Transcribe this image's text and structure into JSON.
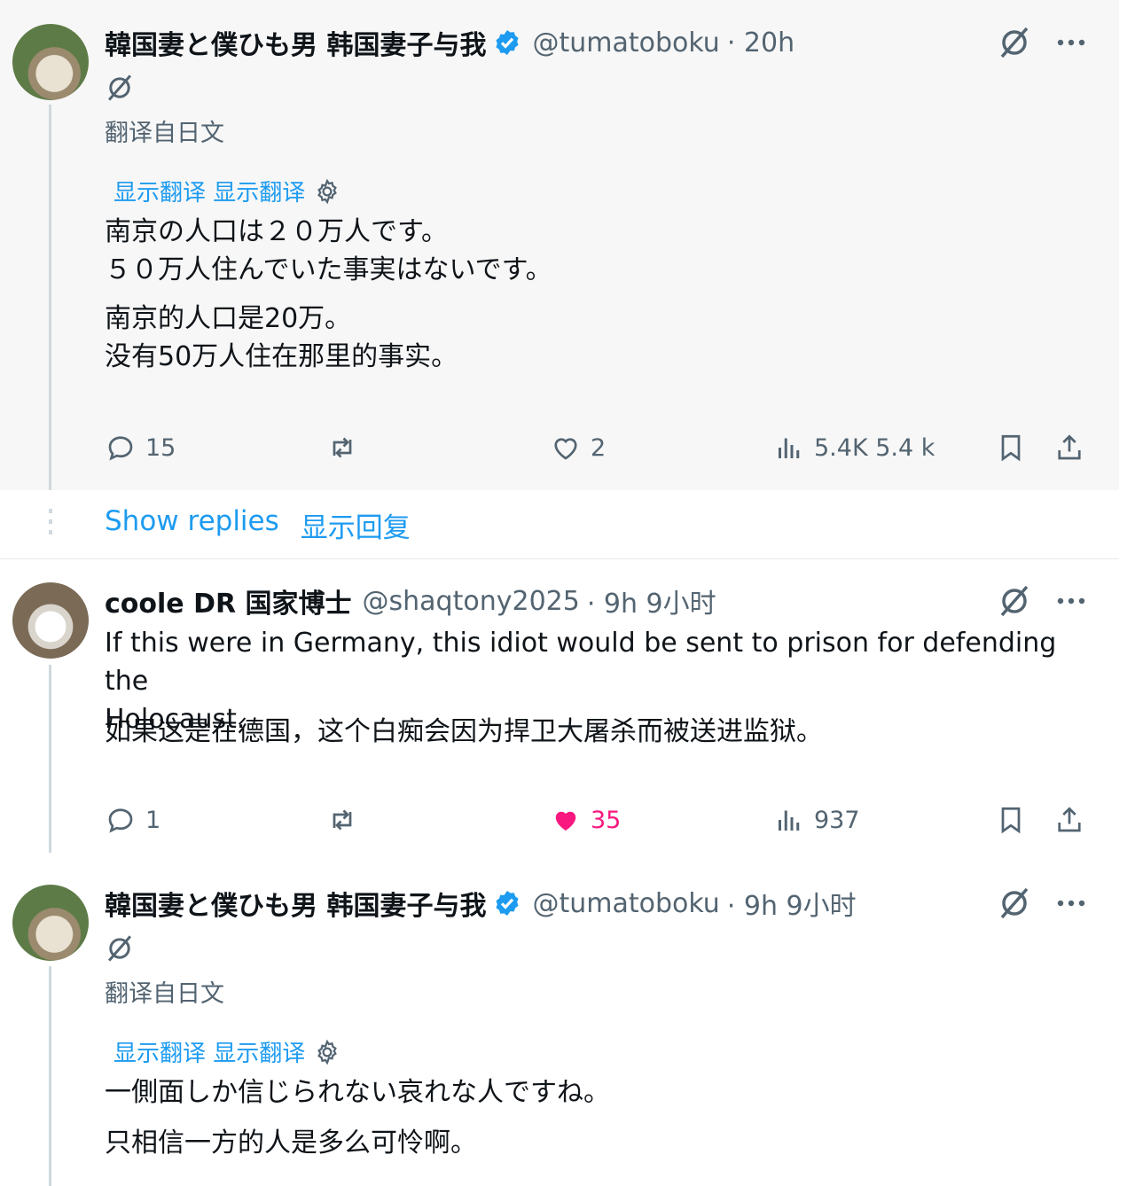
{
  "tweets": [
    {
      "display_name": "韓国妻と僕ひも男 韩国妻子与我",
      "handle": "@tumatoboku",
      "time": "· 20h",
      "translated_from": "翻译自日文",
      "show_translation": "显示翻译 显示翻译",
      "original_lines": [
        "南京の人口は２０万人です。",
        "５０万人住んでいた事実はないです。"
      ],
      "translated_lines": [
        "南京的人口是20万。",
        "没有50万人住在那里的事实。"
      ],
      "replies": "15",
      "likes": "2",
      "views": "5.4K 5.4 k"
    },
    {
      "display_name": "coole DR 国家博士",
      "handle": "@shaqtony2025",
      "time": "· 9h 9小时",
      "original_lines": [
        "If this were in Germany, this idiot would be sent to prison for defending the",
        "Holocaust."
      ],
      "translated_lines": [
        "如果这是在德国，这个白痴会因为捍卫大屠杀而被送进监狱。"
      ],
      "replies": "1",
      "likes": "35",
      "views": "937",
      "like_color": "#f91880"
    },
    {
      "display_name": "韓国妻と僕ひも男 韩国妻子与我",
      "handle": "@tumatoboku",
      "time": "· 9h 9小时",
      "translated_from": "翻译自日文",
      "show_translation": "显示翻译 显示翻译",
      "original_lines": [
        "一側面しか信じられない哀れな人ですね。"
      ],
      "translated_lines": [
        "只相信一方的人是多么可怜啊。"
      ]
    }
  ],
  "show_replies": {
    "en": "Show replies",
    "zh": "显示回复"
  },
  "colors": {
    "accent": "#1d9bf0",
    "muted": "#536471",
    "verified": "#1d9bf0"
  },
  "icons": [
    "grok-slash-icon",
    "more-icon",
    "verified-badge-icon",
    "gear-icon",
    "reply-icon",
    "retweet-icon",
    "like-icon",
    "views-icon",
    "bookmark-icon",
    "share-icon"
  ]
}
